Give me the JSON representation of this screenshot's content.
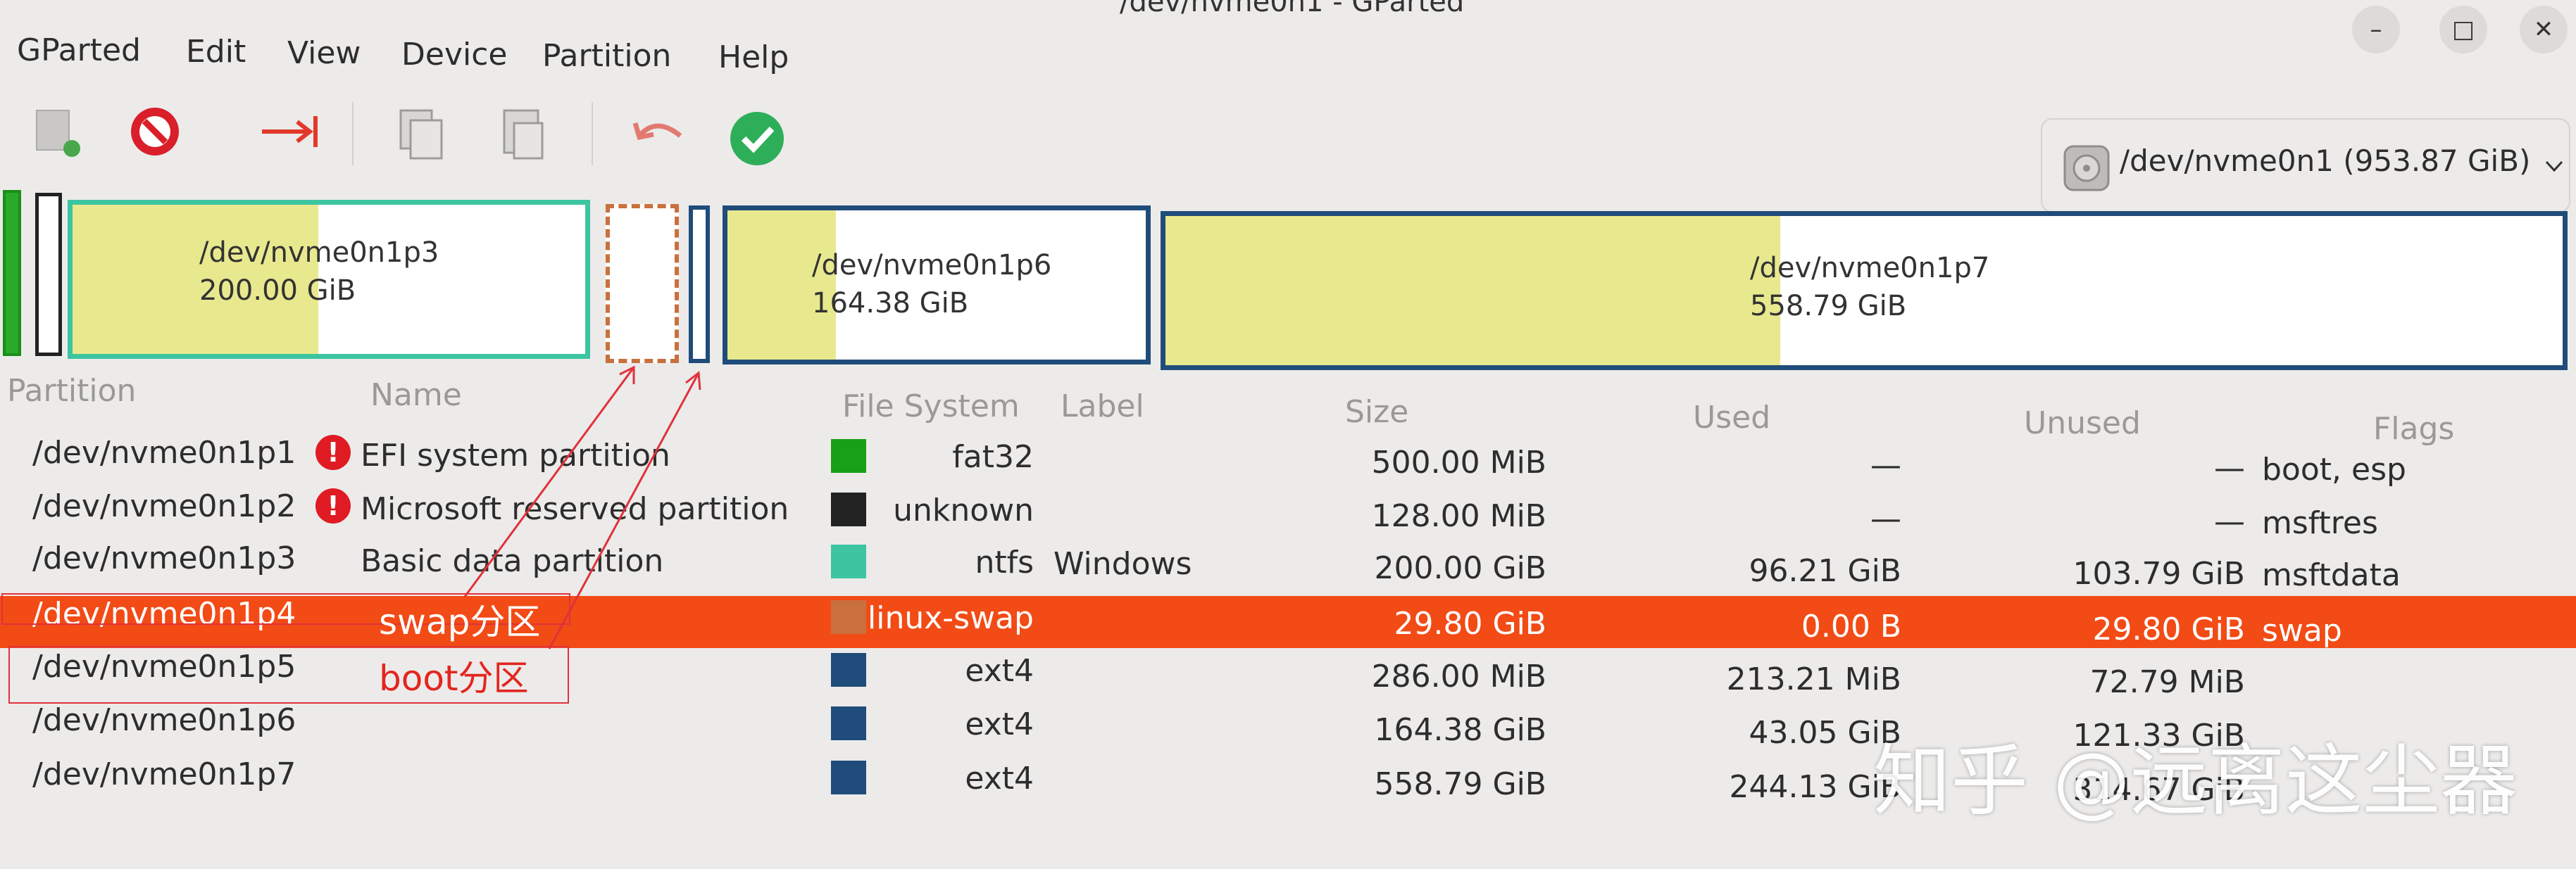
{
  "window": {
    "title": "/dev/nvme0n1 - GParted",
    "min": "–",
    "max": "□",
    "close": "✕"
  },
  "menu": [
    "GParted",
    "Edit",
    "View",
    "Device",
    "Partition",
    "Help"
  ],
  "toolbar": {
    "icons": [
      "new-partition-icon",
      "delete-icon",
      "resize-move-icon",
      "copy-icon",
      "paste-icon",
      "undo-icon",
      "apply-icon"
    ]
  },
  "device": {
    "label": "/dev/nvme0n1 (953.87 GiB)",
    "icon": "disk-icon"
  },
  "diskmap": {
    "p3": {
      "name": "/dev/nvme0n1p3",
      "size": "200.00 GiB",
      "used_fraction": 0.48
    },
    "p6": {
      "name": "/dev/nvme0n1p6",
      "size": "164.38 GiB",
      "used_fraction": 0.26
    },
    "p7": {
      "name": "/dev/nvme0n1p7",
      "size": "558.79 GiB",
      "used_fraction": 0.44
    }
  },
  "columns": [
    "Partition",
    "Name",
    "File System",
    "Label",
    "Size",
    "Used",
    "Unused",
    "Flags"
  ],
  "rows": [
    {
      "partition": "/dev/nvme0n1p1",
      "warn": true,
      "name": "EFI system partition",
      "fs": "fat32",
      "fs_color": "#18a018",
      "label": "",
      "size": "500.00 MiB",
      "used": "—",
      "unused": "—",
      "flags": "boot, esp"
    },
    {
      "partition": "/dev/nvme0n1p2",
      "warn": true,
      "name": "Microsoft reserved partition",
      "fs": "unknown",
      "fs_color": "#222222",
      "label": "",
      "size": "128.00 MiB",
      "used": "—",
      "unused": "—",
      "flags": "msftres"
    },
    {
      "partition": "/dev/nvme0n1p3",
      "warn": false,
      "name": "Basic data partition",
      "fs": "ntfs",
      "fs_color": "#3cc5a0",
      "label": "Windows",
      "size": "200.00 GiB",
      "used": "96.21 GiB",
      "unused": "103.79 GiB",
      "flags": "msftdata"
    },
    {
      "partition": "/dev/nvme0n1p4",
      "warn": false,
      "name": "",
      "fs": "linux-swap",
      "fs_color": "#c9703d",
      "label": "",
      "size": "29.80 GiB",
      "used": "0.00 B",
      "unused": "29.80 GiB",
      "flags": "swap"
    },
    {
      "partition": "/dev/nvme0n1p5",
      "warn": false,
      "name": "",
      "fs": "ext4",
      "fs_color": "#1f4c7a",
      "label": "",
      "size": "286.00 MiB",
      "used": "213.21 MiB",
      "unused": "72.79 MiB",
      "flags": ""
    },
    {
      "partition": "/dev/nvme0n1p6",
      "warn": false,
      "name": "",
      "fs": "ext4",
      "fs_color": "#1f4c7a",
      "label": "",
      "size": "164.38 GiB",
      "used": "43.05 GiB",
      "unused": "121.33 GiB",
      "flags": ""
    },
    {
      "partition": "/dev/nvme0n1p7",
      "warn": false,
      "name": "",
      "fs": "ext4",
      "fs_color": "#1f4c7a",
      "label": "",
      "size": "558.79 GiB",
      "used": "244.13 GiB",
      "unused": "314.67 GiB",
      "flags": ""
    }
  ],
  "annotations": {
    "swap": "swap分区",
    "boot": "boot分区"
  },
  "watermark": "知乎 @远离这尘器"
}
